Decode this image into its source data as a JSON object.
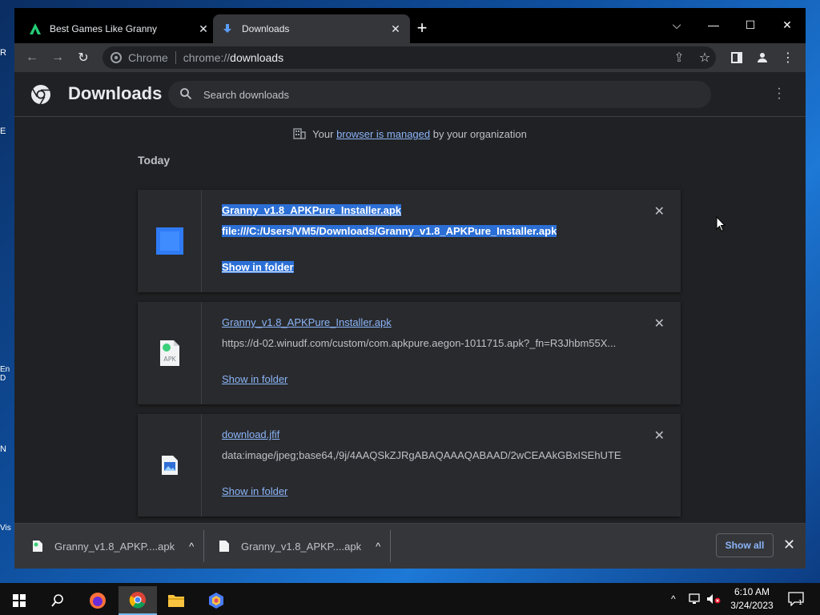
{
  "desktop": {
    "icon_letters": [
      "R",
      "E",
      "En D",
      "N",
      "Vis"
    ]
  },
  "window": {
    "tabs": [
      {
        "title": "Best Games Like Granny",
        "active": false
      },
      {
        "title": "Downloads",
        "active": true
      }
    ],
    "new_tab": "+",
    "controls": {
      "tab_search": "⌵",
      "minimize": "—",
      "maximize": "☐",
      "close": "✕"
    }
  },
  "toolbar": {
    "url_label": "Chrome",
    "url_scheme": "chrome://",
    "url_host": "downloads"
  },
  "downloads_page": {
    "title": "Downloads",
    "search_placeholder": "Search downloads",
    "managed_prefix": "Your ",
    "managed_link": "browser is managed",
    "managed_suffix": " by your organization",
    "section": "Today",
    "items": [
      {
        "filename": "Granny_v1.8_APKPure_Installer.apk",
        "url": "file:///C:/Users/VM5/Downloads/Granny_v1.8_APKPure_Installer.apk",
        "action": "Show in folder",
        "icon": "blue-file-icon",
        "selected": true
      },
      {
        "filename": "Granny_v1.8_APKPure_Installer.apk",
        "url": "https://d-02.winudf.com/custom/com.apkpure.aegon-1011715.apk?_fn=R3Jhbm55X...",
        "action": "Show in folder",
        "icon": "apk-file-icon",
        "selected": false
      },
      {
        "filename": "download.jfif",
        "url": "data:image/jpeg;base64,/9j/4AAQSkZJRgABAQAAAQABAAD/2wCEAAkGBxISEhUTE...",
        "action": "Show in folder",
        "icon": "image-file-icon",
        "selected": false
      }
    ]
  },
  "shelf": {
    "items": [
      {
        "label": "Granny_v1.8_APKP....apk"
      },
      {
        "label": "Granny_v1.8_APKP....apk"
      }
    ],
    "show_all": "Show all"
  },
  "taskbar": {
    "time": "6:10 AM",
    "date": "3/24/2023",
    "notification_count": "1"
  },
  "colors": {
    "accent": "#8ab4f8",
    "selection": "#2b6fd6",
    "page_bg": "#202124"
  }
}
